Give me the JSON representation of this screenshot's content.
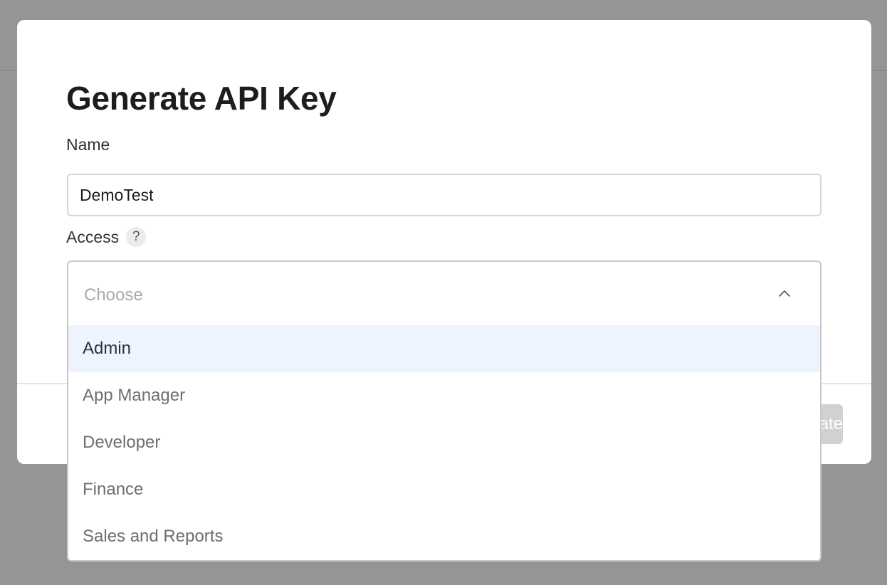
{
  "modal": {
    "title": "Generate API Key",
    "name_label": "Name",
    "name_value": "DemoTest",
    "access_label": "Access",
    "help_icon_glyph": "?",
    "footer_button_label": "Generate"
  },
  "access_select": {
    "placeholder": "Choose",
    "expanded": true,
    "highlighted_option": "Admin",
    "options": [
      "Admin",
      "App Manager",
      "Developer",
      "Finance",
      "Sales and Reports"
    ]
  },
  "colors": {
    "overlay": "#959595",
    "highlight": "#edf4fe",
    "disabled_button": "#d1d1d1"
  }
}
